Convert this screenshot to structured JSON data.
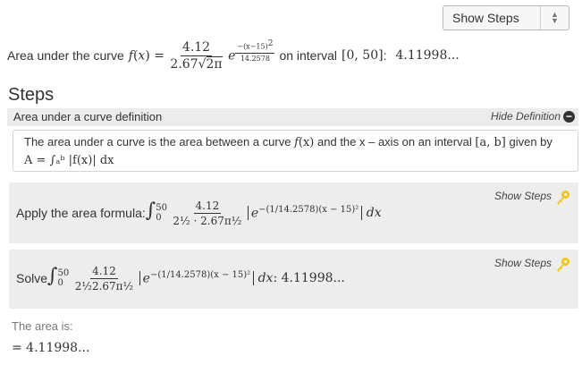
{
  "top_select": {
    "label": "Show Steps"
  },
  "headline": {
    "prefix": "Area under the curve",
    "func_name": "f",
    "func_var": "x",
    "num": "4.12",
    "den_coef": "2.67",
    "den_root": "2π",
    "exp_num": "−(x−15)",
    "exp_pow": "2",
    "exp_den": "14.2578",
    "on_interval": "on interval",
    "interval": "[0, 50]",
    "colon": ":",
    "value": "4.11998..."
  },
  "steps_title": "Steps",
  "definition": {
    "title": "Area under a curve definition",
    "hide_label": "Hide Definition",
    "line1_a": "The area under a curve is the area between a curve",
    "line1_b": "and the x – axis on an interval",
    "line1_interval": "[a, b]",
    "line1_c": "given by",
    "line2": "A = ∫ₐᵇ |f(x)| dx"
  },
  "step1": {
    "label": "Apply the area formula:",
    "show_label": "Show Steps",
    "upper": "50",
    "lower": "0",
    "num": "4.12",
    "den": "2½ · 2.67π½",
    "exp": "−(1/14.2578)(x − 15)²"
  },
  "step2": {
    "label": "Solve",
    "show_label": "Show Steps",
    "upper": "50",
    "lower": "0",
    "num": "4.12",
    "den": "2½2.67π½",
    "exp": "−(1/14.2578)(x − 15)²",
    "result": "4.11998..."
  },
  "result": {
    "label": "The area is:",
    "value": "= 4.11998..."
  },
  "icons": {
    "select_arrows": "updown-arrows-icon",
    "hide_icon": "minus-circle-icon",
    "key_icon": "key-icon",
    "key_color": "#f1c40f"
  }
}
